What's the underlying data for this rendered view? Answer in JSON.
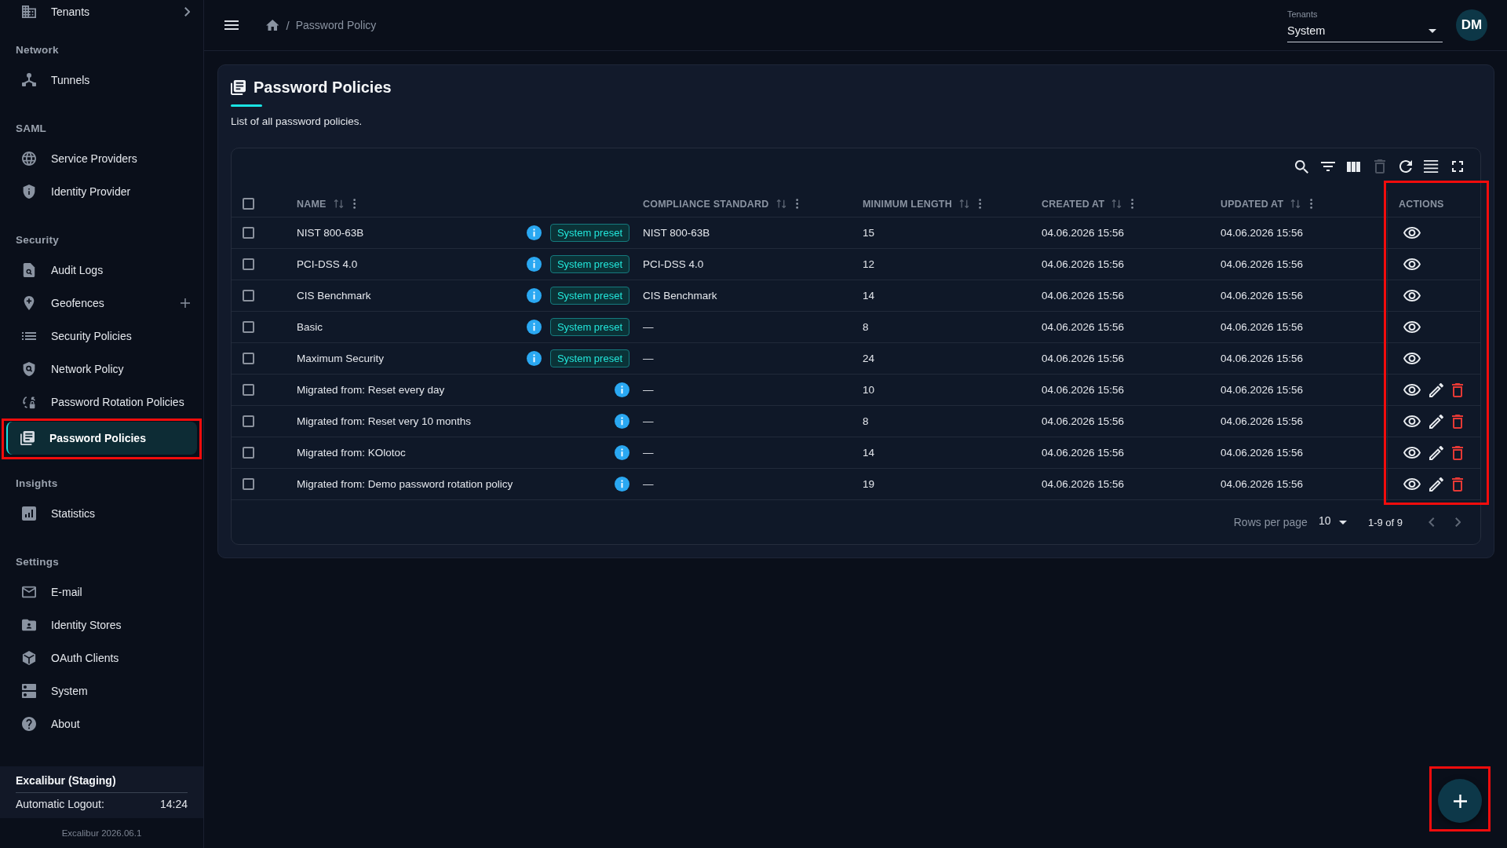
{
  "sidebar": {
    "sections": [
      {
        "items": [
          {
            "label": "Tenants",
            "kind": "group",
            "expanded": false,
            "selected": false,
            "highlighted": false
          }
        ]
      },
      {
        "title": "Network",
        "items": [
          {
            "label": "Tunnels",
            "kind": "link",
            "selected": false,
            "highlighted": false
          }
        ]
      },
      {
        "title": "SAML",
        "items": [
          {
            "label": "Service Providers",
            "kind": "link",
            "selected": false,
            "highlighted": false
          },
          {
            "label": "Identity Provider",
            "kind": "link",
            "selected": false,
            "highlighted": false
          }
        ]
      },
      {
        "title": "Security",
        "items": [
          {
            "label": "Audit Logs",
            "kind": "link",
            "selected": false,
            "highlighted": false
          },
          {
            "label": "Geofences",
            "kind": "addable",
            "selected": false,
            "highlighted": false
          },
          {
            "label": "Security Policies",
            "kind": "link",
            "selected": false,
            "highlighted": false
          },
          {
            "label": "Network Policy",
            "kind": "link",
            "selected": false,
            "highlighted": false
          },
          {
            "label": "Password Rotation Policies",
            "kind": "link",
            "selected": false,
            "highlighted": false
          },
          {
            "label": "Password Policies",
            "kind": "link",
            "selected": true,
            "highlighted": true
          }
        ]
      },
      {
        "title": "Insights",
        "items": [
          {
            "label": "Statistics",
            "kind": "link",
            "selected": false,
            "highlighted": false
          }
        ]
      },
      {
        "title": "Settings",
        "items": [
          {
            "label": "E-mail",
            "kind": "link",
            "selected": false,
            "highlighted": false
          },
          {
            "label": "Identity Stores",
            "kind": "link",
            "selected": false,
            "highlighted": false
          },
          {
            "label": "OAuth Clients",
            "kind": "link",
            "selected": false,
            "highlighted": false
          },
          {
            "label": "System",
            "kind": "link",
            "selected": false,
            "highlighted": false
          },
          {
            "label": "About",
            "kind": "link",
            "selected": false,
            "highlighted": false
          }
        ]
      }
    ],
    "session": {
      "title": "Excalibur (Staging)",
      "logout_label": "Automatic Logout:",
      "logout_time": "14:24"
    },
    "version": "Excalibur 2026.06.1"
  },
  "topbar": {
    "breadcrumb": {
      "separator": "/",
      "current": "Password Policy"
    },
    "tenant_select": {
      "label": "Tenants",
      "value": "System"
    },
    "avatar": {
      "initials": "DM"
    }
  },
  "page": {
    "title": "Password Policies",
    "subtitle": "List of all password policies."
  },
  "table": {
    "toolbar": [
      {
        "disabled": false
      },
      {
        "disabled": false
      },
      {
        "disabled": false
      },
      {
        "disabled": true
      },
      {
        "disabled": false
      },
      {
        "disabled": false
      },
      {
        "disabled": false
      }
    ],
    "select_all": {
      "checked": false
    },
    "columns": [
      {
        "label": "NAME",
        "sortable": true,
        "menu": true,
        "highlighted": false
      },
      {
        "label": "COMPLIANCE STANDARD",
        "sortable": true,
        "menu": true,
        "highlighted": false
      },
      {
        "label": "MINIMUM LENGTH",
        "sortable": true,
        "menu": true,
        "highlighted": false
      },
      {
        "label": "CREATED AT",
        "sortable": true,
        "menu": true,
        "highlighted": false
      },
      {
        "label": "UPDATED AT",
        "sortable": true,
        "menu": true,
        "highlighted": false
      },
      {
        "label": "ACTIONS",
        "sortable": false,
        "menu": false,
        "highlighted": true
      }
    ],
    "rows": [
      {
        "selected": false,
        "name": "NIST 800-63B",
        "badge": "System preset",
        "compliance_standard": "NIST 800-63B",
        "minimum_length": "15",
        "created_at": "04.06.2026 15:56",
        "updated_at": "04.06.2026 15:56",
        "editable": false,
        "deletable": false
      },
      {
        "selected": false,
        "name": "PCI-DSS 4.0",
        "badge": "System preset",
        "compliance_standard": "PCI-DSS 4.0",
        "minimum_length": "12",
        "created_at": "04.06.2026 15:56",
        "updated_at": "04.06.2026 15:56",
        "editable": false,
        "deletable": false
      },
      {
        "selected": false,
        "name": "CIS Benchmark",
        "badge": "System preset",
        "compliance_standard": "CIS Benchmark",
        "minimum_length": "14",
        "created_at": "04.06.2026 15:56",
        "updated_at": "04.06.2026 15:56",
        "editable": false,
        "deletable": false
      },
      {
        "selected": false,
        "name": "Basic",
        "badge": "System preset",
        "compliance_standard": "—",
        "minimum_length": "8",
        "created_at": "04.06.2026 15:56",
        "updated_at": "04.06.2026 15:56",
        "editable": false,
        "deletable": false
      },
      {
        "selected": false,
        "name": "Maximum Security",
        "badge": "System preset",
        "compliance_standard": "—",
        "minimum_length": "24",
        "created_at": "04.06.2026 15:56",
        "updated_at": "04.06.2026 15:56",
        "editable": false,
        "deletable": false
      },
      {
        "selected": false,
        "name": "Migrated from: Reset every day",
        "compliance_standard": "—",
        "minimum_length": "10",
        "created_at": "04.06.2026 15:56",
        "updated_at": "04.06.2026 15:56",
        "editable": true,
        "deletable": true
      },
      {
        "selected": false,
        "name": "Migrated from: Reset very 10 months",
        "compliance_standard": "—",
        "minimum_length": "8",
        "created_at": "04.06.2026 15:56",
        "updated_at": "04.06.2026 15:56",
        "editable": true,
        "deletable": true
      },
      {
        "selected": false,
        "name": "Migrated from: KOlotoc",
        "compliance_standard": "—",
        "minimum_length": "14",
        "created_at": "04.06.2026 15:56",
        "updated_at": "04.06.2026 15:56",
        "editable": true,
        "deletable": true
      },
      {
        "selected": false,
        "name": "Migrated from: Demo password rotation policy",
        "compliance_standard": "—",
        "minimum_length": "19",
        "created_at": "04.06.2026 15:56",
        "updated_at": "04.06.2026 15:56",
        "editable": true,
        "deletable": true
      }
    ],
    "pagination": {
      "rows_per_page_label": "Rows per page",
      "rows_per_page": "10",
      "range": "1-9 of 9",
      "prev_disabled": true,
      "next_disabled": true
    }
  },
  "add_button": {
    "highlighted": true
  }
}
